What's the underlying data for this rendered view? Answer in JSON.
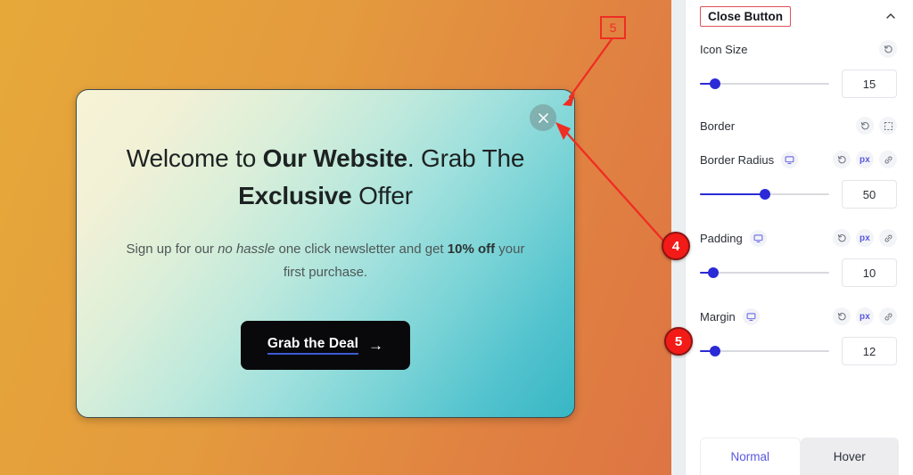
{
  "preview": {
    "background_gradient_from": "#e6a939",
    "background_gradient_to": "#de7543",
    "popup": {
      "close_button_label": "×",
      "title_part1": "Welcome to ",
      "title_bold1": "Our Website",
      "title_part2": ". Grab The ",
      "title_bold2": "Exclusive",
      "title_part3": " Offer",
      "subtitle_part1": "Sign up for our ",
      "subtitle_italic": "no hassle",
      "subtitle_part2": " one click newsletter and get ",
      "subtitle_bold1": "10% off",
      "subtitle_part3": " your first purchase.",
      "cta_label": "Grab the Deal",
      "cta_arrow": "→"
    }
  },
  "panel": {
    "header": {
      "title": "Close Button",
      "collapse_icon": "chevron-up-icon"
    },
    "controls": [
      {
        "id": "icon-size",
        "label": "Icon Size",
        "icons": [
          "reset-icon"
        ],
        "value": "15",
        "slider_percent": 12
      },
      {
        "id": "border",
        "label": "Border",
        "icons": [
          "reset-icon",
          "border-box-icon"
        ],
        "value": null,
        "slider_percent": null
      },
      {
        "id": "border-radius",
        "label": "Border Radius",
        "device_icon": "desktop-icon",
        "icons": [
          "reset-icon",
          "px-unit-icon",
          "link-icon"
        ],
        "unit": "px",
        "value": "50",
        "slider_percent": 50
      },
      {
        "id": "padding",
        "label": "Padding",
        "device_icon": "desktop-icon",
        "icons": [
          "reset-icon",
          "px-unit-icon",
          "link-icon"
        ],
        "unit": "px",
        "value": "10",
        "slider_percent": 10
      },
      {
        "id": "margin",
        "label": "Margin",
        "device_icon": "desktop-icon",
        "icons": [
          "reset-icon",
          "px-unit-icon",
          "link-icon"
        ],
        "unit": "px",
        "value": "12",
        "slider_percent": 12
      }
    ],
    "tabs": [
      {
        "label": "Normal",
        "active": true
      },
      {
        "label": "Hover",
        "active": false
      }
    ]
  },
  "annotations": {
    "accent_color": "#ef2d22",
    "title_highlight_color": "#e0505a",
    "markers": [
      {
        "id": "marker-box-5",
        "label": "5",
        "shape": "box"
      },
      {
        "id": "marker-circle-4",
        "label": "4",
        "shape": "circle"
      },
      {
        "id": "marker-circle-5",
        "label": "5",
        "shape": "circle"
      }
    ]
  }
}
